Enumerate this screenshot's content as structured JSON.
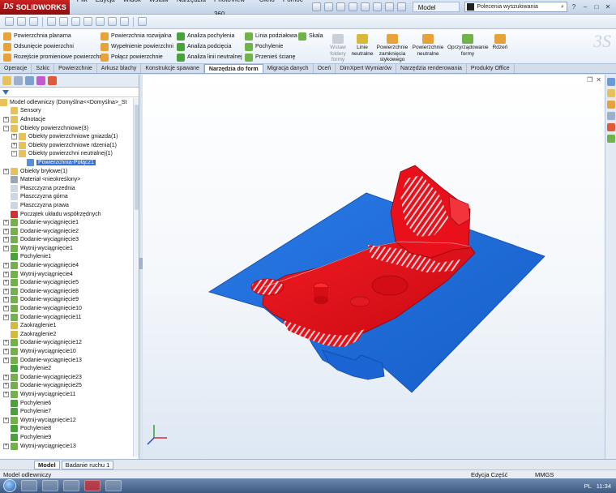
{
  "app": {
    "logo_mark": "DS",
    "logo_text": "SOLIDWORKS",
    "menus": [
      "Plik",
      "Edycja",
      "Widok",
      "Wstaw",
      "Narzędzia",
      "PhotoView 360",
      "Okno",
      "Pomoc"
    ],
    "window_title": "Model odle...",
    "search_placeholder": "Polecenia wyszukiwania",
    "window_buttons": [
      "?",
      "–",
      "□",
      "✕"
    ]
  },
  "ribbon": {
    "col1": [
      "Powierzchnia planarna",
      "Odsunięcie powierzchni",
      "Rozejście promieniowe powierzchni"
    ],
    "col2": [
      "Powierzchnia rozwijalna",
      "Wypełnienie powierzchni",
      "Połącz powierzchnie"
    ],
    "col3": [
      "Analiza pochylenia",
      "Analiza podcięcia",
      "Analiza linii neutralnej"
    ],
    "col4": [
      "Linia podziałowa",
      "Pochylenie",
      "Przenieś ścianę"
    ],
    "col5": [
      "Skala"
    ],
    "big_buttons": [
      {
        "lines": [
          "Wstaw",
          "foldery",
          "formy"
        ],
        "disabled": true
      },
      {
        "lines": [
          "Linie",
          "neutralne"
        ],
        "disabled": false
      },
      {
        "lines": [
          "Powierzchnie",
          "zamknięcia",
          "stykowego"
        ],
        "disabled": false
      },
      {
        "lines": [
          "Powierzchnie",
          "neutralne"
        ],
        "disabled": false
      },
      {
        "lines": [
          "Oprzyrządowanie",
          "formy"
        ],
        "disabled": false
      },
      {
        "lines": [
          "Rdzeń"
        ],
        "disabled": false
      }
    ]
  },
  "tabs": [
    "Operacje",
    "Szkic",
    "Powierzchnie",
    "Arkusz blachy",
    "Konstrukcje spawane",
    "Narzędzia do form",
    "Migracja danych",
    "Oceń",
    "DimXpert Wymiarów",
    "Narzędzia renderowania",
    "Produkty Office"
  ],
  "active_tab": "Narzędzia do form",
  "tree": {
    "root": "Model odlewniczy  (Domyślna<<Domyślna>_St",
    "items": [
      {
        "label": "Sensory",
        "depth": 0,
        "exp": "none",
        "icon": "#e8c15a"
      },
      {
        "label": "Adnotacje",
        "depth": 0,
        "exp": "+",
        "icon": "#e8c15a"
      },
      {
        "label": "Obiekty powierzchniowe(3)",
        "depth": 0,
        "exp": "-",
        "icon": "#e8c15a"
      },
      {
        "label": "Obiekty powierzchniowe gniazda(1)",
        "depth": 1,
        "exp": "+",
        "icon": "#e8c15a"
      },
      {
        "label": "Obiekty powierzchniowe rdzenia(1)",
        "depth": 1,
        "exp": "+",
        "icon": "#e8c15a"
      },
      {
        "label": "Obiekty powierzchni neutralnej(1)",
        "depth": 1,
        "exp": "-",
        "icon": "#e8c15a"
      },
      {
        "label": "Powierzchnia-Połącz1",
        "depth": 2,
        "exp": "none",
        "icon": "#5a8fd6",
        "selected": true
      },
      {
        "label": "Obiekty bryłowe(1)",
        "depth": 0,
        "exp": "+",
        "icon": "#e8c15a"
      },
      {
        "label": "Materiał <nieokreślony>",
        "depth": 0,
        "exp": "none",
        "icon": "#9aa6b5"
      },
      {
        "label": "Płaszczyzna przednia",
        "depth": 0,
        "exp": "none",
        "icon": "#cdd7e3"
      },
      {
        "label": "Płaszczyzna górna",
        "depth": 0,
        "exp": "none",
        "icon": "#cdd7e3"
      },
      {
        "label": "Płaszczyzna prawa",
        "depth": 0,
        "exp": "none",
        "icon": "#cdd7e3"
      },
      {
        "label": "Początek układu współrzędnych",
        "depth": 0,
        "exp": "none",
        "icon": "#c33"
      },
      {
        "label": "Dodanie-wyciągnięcie1",
        "depth": 0,
        "exp": "+",
        "icon": "#6fb34a"
      },
      {
        "label": "Dodanie-wyciągnięcie2",
        "depth": 0,
        "exp": "+",
        "icon": "#6fb34a"
      },
      {
        "label": "Dodanie-wyciągnięcie3",
        "depth": 0,
        "exp": "+",
        "icon": "#6fb34a"
      },
      {
        "label": "Wytnij-wyciągnięcie1",
        "depth": 0,
        "exp": "+",
        "icon": "#6fb34a"
      },
      {
        "label": "Pochylenie1",
        "depth": 0,
        "exp": "none",
        "icon": "#4aa33a"
      },
      {
        "label": "Dodanie-wyciągnięcie4",
        "depth": 0,
        "exp": "+",
        "icon": "#6fb34a"
      },
      {
        "label": "Wytnij-wyciągnięcie4",
        "depth": 0,
        "exp": "+",
        "icon": "#6fb34a"
      },
      {
        "label": "Dodanie-wyciągnięcie5",
        "depth": 0,
        "exp": "+",
        "icon": "#6fb34a"
      },
      {
        "label": "Dodanie-wyciągnięcie8",
        "depth": 0,
        "exp": "+",
        "icon": "#6fb34a"
      },
      {
        "label": "Dodanie-wyciągnięcie9",
        "depth": 0,
        "exp": "+",
        "icon": "#6fb34a"
      },
      {
        "label": "Dodanie-wyciągnięcie10",
        "depth": 0,
        "exp": "+",
        "icon": "#6fb34a"
      },
      {
        "label": "Dodanie-wyciągnięcie11",
        "depth": 0,
        "exp": "+",
        "icon": "#6fb34a"
      },
      {
        "label": "Zaokrąglenie1",
        "depth": 0,
        "exp": "none",
        "icon": "#d9b93a"
      },
      {
        "label": "Zaokrąglenie2",
        "depth": 0,
        "exp": "none",
        "icon": "#d9b93a"
      },
      {
        "label": "Dodanie-wyciągnięcie12",
        "depth": 0,
        "exp": "+",
        "icon": "#6fb34a"
      },
      {
        "label": "Wytnij-wyciągnięcie10",
        "depth": 0,
        "exp": "+",
        "icon": "#6fb34a"
      },
      {
        "label": "Dodanie-wyciągnięcie13",
        "depth": 0,
        "exp": "+",
        "icon": "#6fb34a"
      },
      {
        "label": "Pochylenie2",
        "depth": 0,
        "exp": "none",
        "icon": "#4aa33a"
      },
      {
        "label": "Dodanie-wyciągnięcie23",
        "depth": 0,
        "exp": "+",
        "icon": "#6fb34a"
      },
      {
        "label": "Dodanie-wyciągnięcie25",
        "depth": 0,
        "exp": "+",
        "icon": "#6fb34a"
      },
      {
        "label": "Wytnij-wyciągnięcie11",
        "depth": 0,
        "exp": "+",
        "icon": "#6fb34a"
      },
      {
        "label": "Pochylenie6",
        "depth": 0,
        "exp": "none",
        "icon": "#4aa33a"
      },
      {
        "label": "Pochylenie7",
        "depth": 0,
        "exp": "none",
        "icon": "#4aa33a"
      },
      {
        "label": "Wytnij-wyciągnięcie12",
        "depth": 0,
        "exp": "+",
        "icon": "#6fb34a"
      },
      {
        "label": "Pochylenie8",
        "depth": 0,
        "exp": "none",
        "icon": "#4aa33a"
      },
      {
        "label": "Pochylenie9",
        "depth": 0,
        "exp": "none",
        "icon": "#4aa33a"
      },
      {
        "label": "Wytnij-wyciągnięcie13",
        "depth": 0,
        "exp": "+",
        "icon": "#6fb34a"
      }
    ]
  },
  "bottom_tabs": [
    "Model",
    "Badanie ruchu 1"
  ],
  "status": {
    "left": "Model odlewniczy",
    "mode": "Edycja Część",
    "units": "MMGS"
  },
  "taskbar": {
    "lang": "PL",
    "time": "11:34"
  },
  "colors": {
    "part_red": "#e8101a",
    "surface_blue": "#1f6fdc",
    "selection": "#3371d6"
  }
}
